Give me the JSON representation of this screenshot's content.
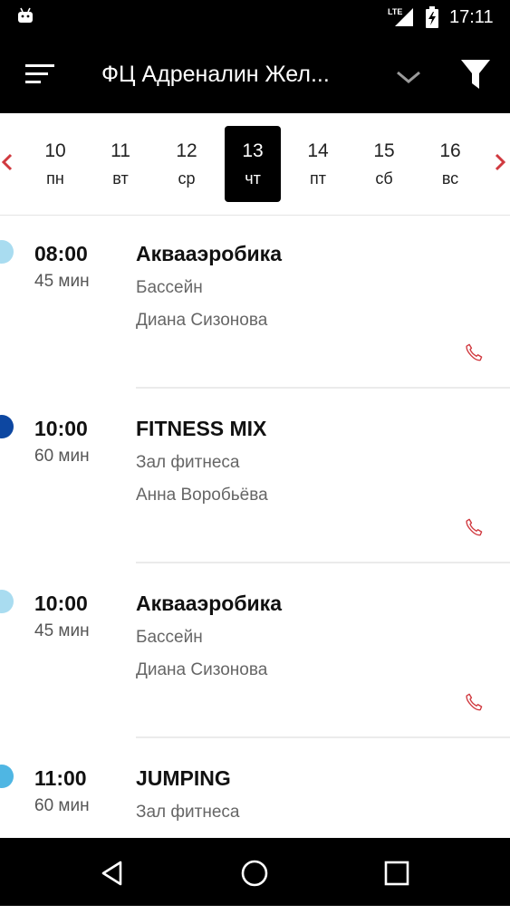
{
  "status_bar": {
    "network": "LTE",
    "time": "17:11"
  },
  "app_bar": {
    "title": "ФЦ Адреналин Жел..."
  },
  "date_strip": {
    "days": [
      {
        "num": "10",
        "dow": "пн"
      },
      {
        "num": "11",
        "dow": "вт"
      },
      {
        "num": "12",
        "dow": "ср"
      },
      {
        "num": "13",
        "dow": "чт",
        "selected": true
      },
      {
        "num": "14",
        "dow": "пт"
      },
      {
        "num": "15",
        "dow": "сб"
      },
      {
        "num": "16",
        "dow": "вс"
      }
    ]
  },
  "sessions": [
    {
      "time": "08:00",
      "duration": "45 мин",
      "name": "Аквааэробика",
      "room": "Бассейн",
      "trainer": "Диана Сизонова",
      "color": "#a9dcf0"
    },
    {
      "time": "10:00",
      "duration": "60 мин",
      "name": "FITNESS MIX",
      "room": "Зал фитнеса",
      "trainer": "Анна Воробьёва",
      "color": "#0d47a1"
    },
    {
      "time": "10:00",
      "duration": "45 мин",
      "name": "Аквааэробика",
      "room": "Бассейн",
      "trainer": "Диана Сизонова",
      "color": "#a9dcf0"
    },
    {
      "time": "11:00",
      "duration": "60 мин",
      "name": "JUMPING",
      "room": "Зал фитнеса",
      "trainer": "",
      "color": "#4fb6e3"
    }
  ],
  "colors": {
    "accent": "#d0393f",
    "bar": "#000000"
  },
  "icons": [
    "android-icon",
    "signal-icon",
    "battery-icon",
    "menu-icon",
    "chevron-down-icon",
    "filter-icon",
    "chevron-left-icon",
    "chevron-right-icon",
    "phone-icon",
    "back-icon",
    "home-icon",
    "recents-icon"
  ]
}
